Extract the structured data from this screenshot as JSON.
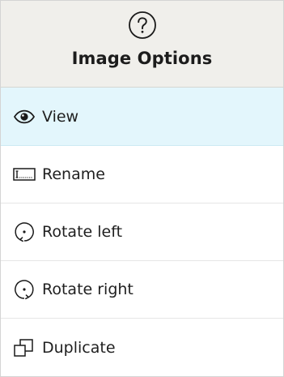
{
  "header": {
    "title": "Image Options",
    "help_icon": "question-circle-icon"
  },
  "menu": {
    "selected_index": 0,
    "items": [
      {
        "label": "View",
        "icon": "eye-icon"
      },
      {
        "label": "Rename",
        "icon": "rename-field-icon"
      },
      {
        "label": "Rotate left",
        "icon": "rotate-left-icon"
      },
      {
        "label": "Rotate right",
        "icon": "rotate-right-icon"
      },
      {
        "label": "Duplicate",
        "icon": "duplicate-icon"
      }
    ]
  },
  "colors": {
    "header_bg": "#f0efeb",
    "selected_bg": "#e3f6fc",
    "text": "#1f1f1f"
  }
}
